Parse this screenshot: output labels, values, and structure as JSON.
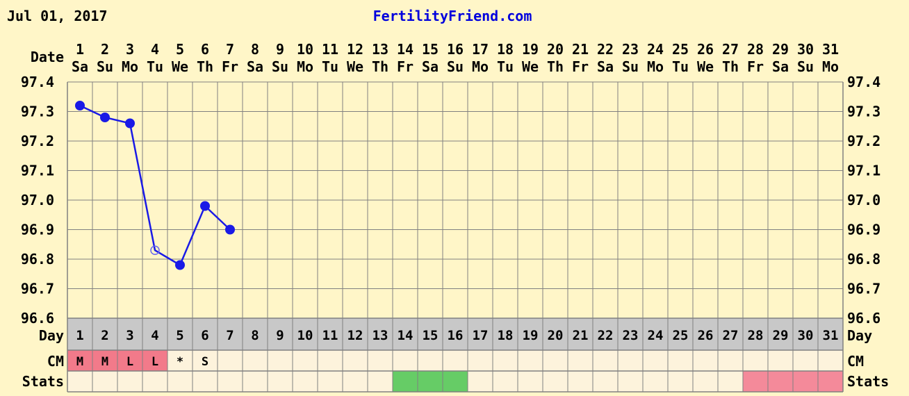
{
  "header": {
    "date": "Jul 01, 2017",
    "site": "FertilityFriend.com"
  },
  "labels": {
    "date": "Date",
    "day": "Day",
    "cm": "CM",
    "stats": "Stats"
  },
  "colors": {
    "background": "#fff6c8",
    "grid": "#808080",
    "day_row": "#c8c8c8",
    "cell": "#fdf3dc",
    "temp_line": "#1a1ae6",
    "cm_pink": "#f27a8a",
    "stats_green": "#66cc66",
    "stats_pink": "#f48a9a"
  },
  "chart_data": {
    "type": "line",
    "title": "",
    "xlabel": "Date",
    "ylabel": "",
    "x": [
      1,
      2,
      3,
      4,
      5,
      6,
      7,
      8,
      9,
      10,
      11,
      12,
      13,
      14,
      15,
      16,
      17,
      18,
      19,
      20,
      21,
      22,
      23,
      24,
      25,
      26,
      27,
      28,
      29,
      30,
      31
    ],
    "weekdays": [
      "Sa",
      "Su",
      "Mo",
      "Tu",
      "We",
      "Th",
      "Fr",
      "Sa",
      "Su",
      "Mo",
      "Tu",
      "We",
      "Th",
      "Fr",
      "Sa",
      "Su",
      "Mo",
      "Tu",
      "We",
      "Th",
      "Fr",
      "Sa",
      "Su",
      "Mo",
      "Tu",
      "We",
      "Th",
      "Fr",
      "Sa",
      "Su",
      "Mo"
    ],
    "y_ticks": [
      "97.4",
      "97.3",
      "97.2",
      "97.1",
      "97.0",
      "96.9",
      "96.8",
      "96.7",
      "96.6"
    ],
    "ylim": [
      96.6,
      97.4
    ],
    "grid": true,
    "series": [
      {
        "values": [
          97.32,
          97.28,
          97.26,
          96.83,
          96.78,
          96.98,
          96.9
        ],
        "open_markers": [
          4
        ]
      }
    ],
    "cycle_days": [
      1,
      2,
      3,
      4,
      5,
      6,
      7,
      8,
      9,
      10,
      11,
      12,
      13,
      14,
      15,
      16,
      17,
      18,
      19,
      20,
      21,
      22,
      23,
      24,
      25,
      26,
      27,
      28,
      29,
      30,
      31
    ],
    "cm": [
      "M",
      "M",
      "L",
      "L",
      "*",
      "S"
    ],
    "cm_highlight": [
      1,
      2,
      3,
      4
    ],
    "stats_green": [
      14,
      15,
      16
    ],
    "stats_pink": [
      28,
      29,
      30,
      31
    ]
  }
}
